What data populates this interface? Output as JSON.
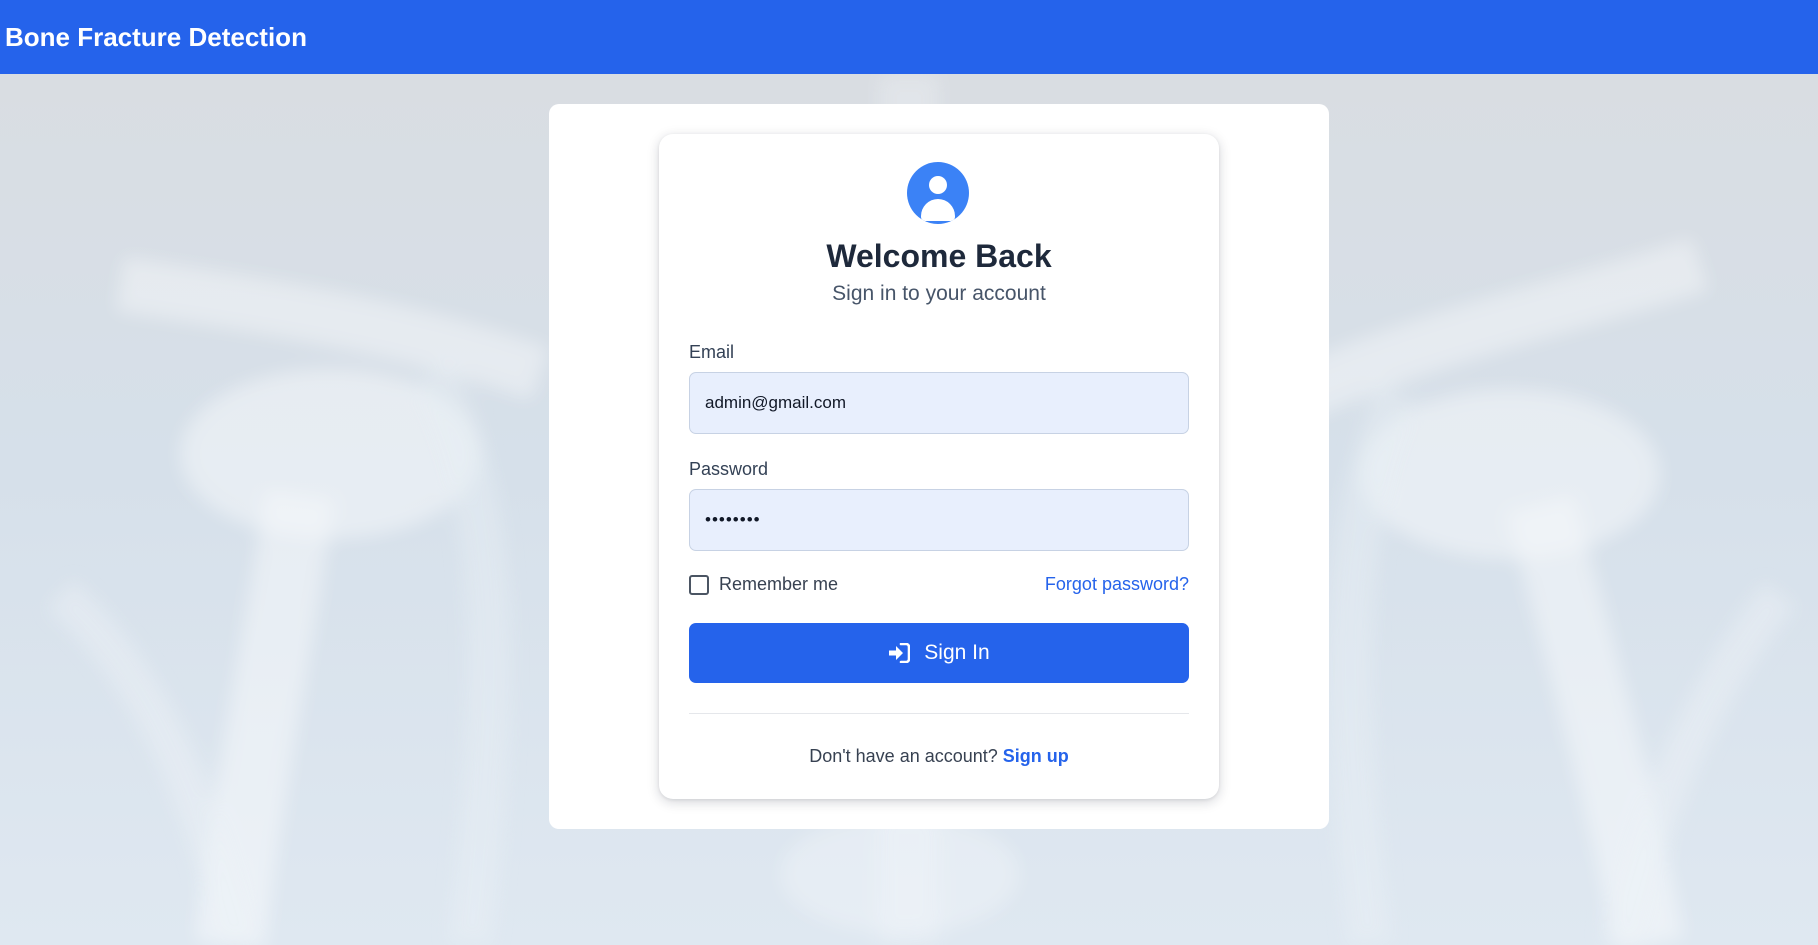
{
  "navbar": {
    "title": "Bone Fracture Detection"
  },
  "login": {
    "avatar_icon": "user-circle-icon",
    "title": "Welcome Back",
    "subtitle": "Sign in to your account",
    "email": {
      "label": "Email",
      "value": "admin@gmail.com"
    },
    "password": {
      "label": "Password",
      "value": "••••••••"
    },
    "remember_label": "Remember me",
    "remember_checked": false,
    "forgot_label": "Forgot password?",
    "signin_icon": "sign-in-icon",
    "signin_label": "Sign In",
    "footer_text": "Don't have an account?",
    "signup_label": "Sign up"
  },
  "colors": {
    "primary": "#2563eb",
    "avatar": "#3b82f6",
    "input_bg": "#e8effd",
    "title": "#1e293b"
  }
}
